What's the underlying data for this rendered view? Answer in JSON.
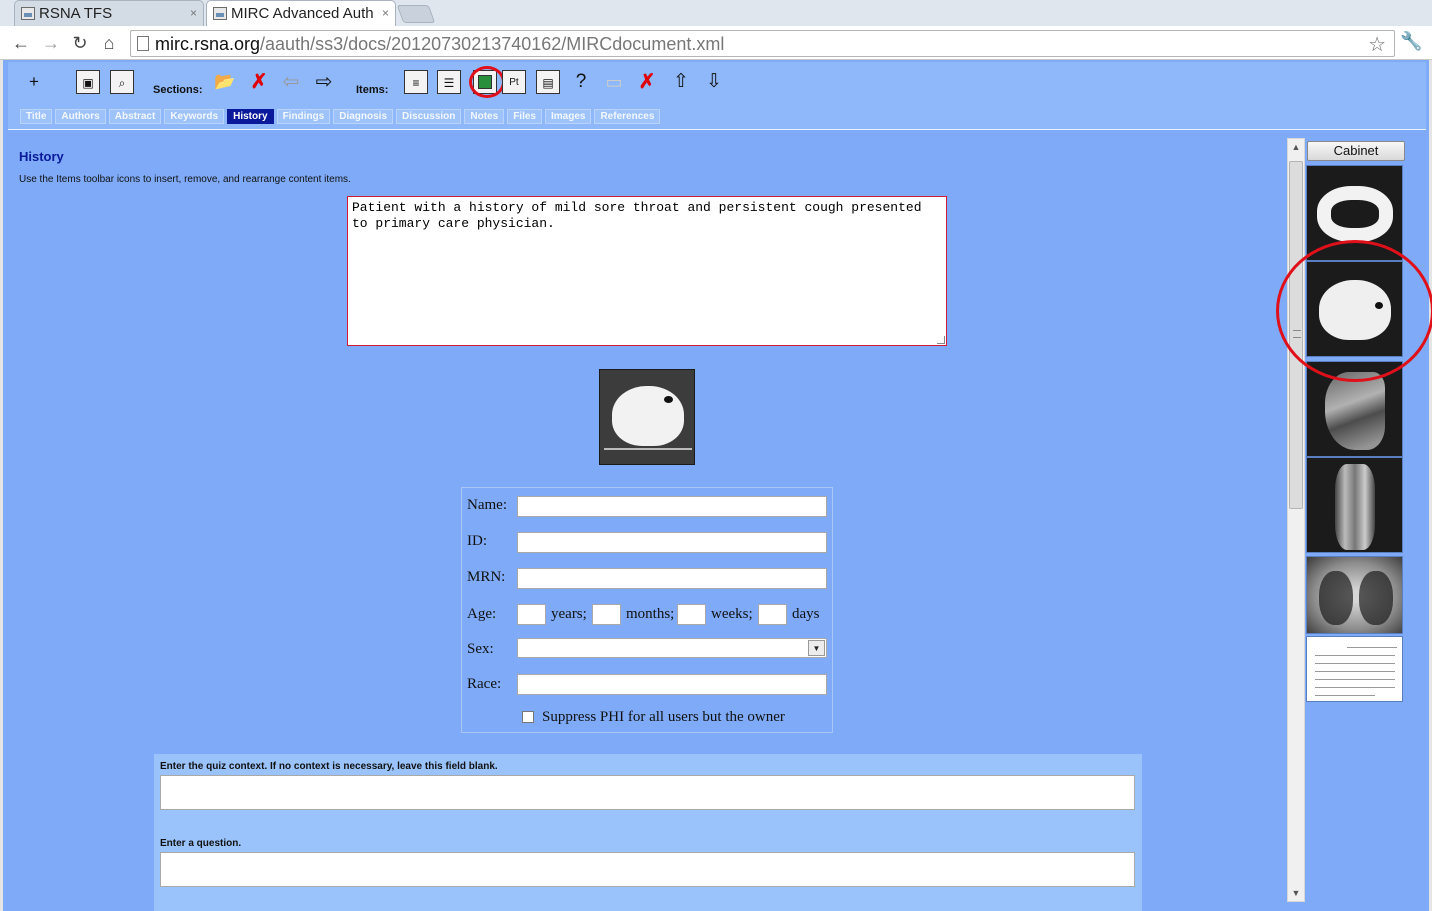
{
  "browser": {
    "tabs": [
      {
        "title": "RSNA TFS"
      },
      {
        "title": "MIRC Advanced Auth"
      }
    ],
    "url_host": "mirc.rsna.org",
    "url_path": "/aauth/ss3/docs/20120730213740162/MIRCdocument.xml"
  },
  "toolbar": {
    "sections_label": "Sections:",
    "items_label": "Items:",
    "plus_glyph": "+",
    "text_item_glyph": "Pt"
  },
  "section_tabs": [
    {
      "label": "Title",
      "active": false
    },
    {
      "label": "Authors",
      "active": false
    },
    {
      "label": "Abstract",
      "active": false
    },
    {
      "label": "Keywords",
      "active": false
    },
    {
      "label": "History",
      "active": true
    },
    {
      "label": "Findings",
      "active": false
    },
    {
      "label": "Diagnosis",
      "active": false
    },
    {
      "label": "Discussion",
      "active": false
    },
    {
      "label": "Notes",
      "active": false
    },
    {
      "label": "Files",
      "active": false
    },
    {
      "label": "Images",
      "active": false
    },
    {
      "label": "References",
      "active": false
    }
  ],
  "section": {
    "title": "History",
    "hint": "Use the Items toolbar icons to insert, remove, and rearrange content items.",
    "history_text": "Patient with a history of mild sore throat and persistent cough presented\nto primary care physician."
  },
  "phi": {
    "name_label": "Name:",
    "id_label": "ID:",
    "mrn_label": "MRN:",
    "age_label": "Age:",
    "years_label": "years;",
    "months_label": "months;",
    "weeks_label": "weeks;",
    "days_label": "days",
    "sex_label": "Sex:",
    "race_label": "Race:",
    "suppress_label": "Suppress PHI for all users but the owner",
    "name_value": "",
    "id_value": "",
    "mrn_value": "",
    "race_value": "",
    "sex_value": ""
  },
  "quiz": {
    "context_label": "Enter the quiz context. If no context is necessary, leave this field blank.",
    "question_label": "Enter a question."
  },
  "cabinet": {
    "button_label": "Cabinet",
    "thumbnails": [
      "ct-chest-lung-window",
      "ct-chest-slice",
      "mri-knee-sagittal",
      "mri-ankle-coronal",
      "chest-xray",
      "document-table"
    ]
  },
  "colors": {
    "app_background": "#7eaaf7",
    "active_tab": "#0a1a9a",
    "annotation_red": "#e0101a"
  }
}
